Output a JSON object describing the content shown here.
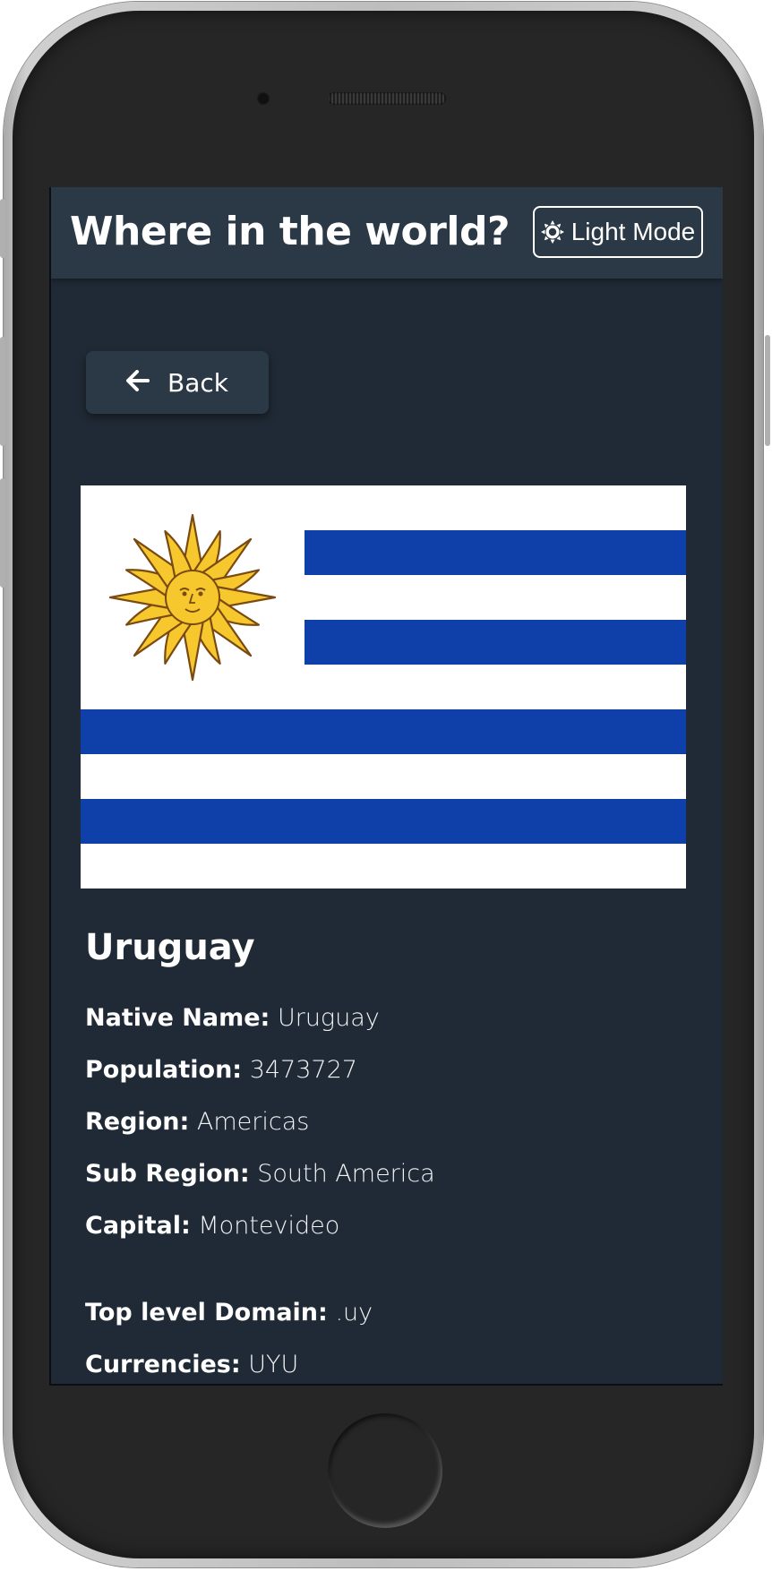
{
  "header": {
    "title": "Where in the world?",
    "mode_toggle_label": "Light Mode",
    "mode_toggle_icon": "sun-icon"
  },
  "back_button": {
    "label": "Back",
    "icon": "arrow-left-icon"
  },
  "flag": {
    "country": "Uruguay",
    "colors": {
      "blue": "#0f3fa8",
      "white": "#ffffff",
      "sun": "#f6c82d",
      "sun_outline": "#7a4a12"
    }
  },
  "country": {
    "name": "Uruguay",
    "details": [
      {
        "key": "native_name",
        "label": "Native Name:",
        "value": "Uruguay"
      },
      {
        "key": "population",
        "label": "Population:",
        "value": "3473727"
      },
      {
        "key": "region",
        "label": "Region:",
        "value": "Americas"
      },
      {
        "key": "sub_region",
        "label": "Sub Region:",
        "value": "South America"
      },
      {
        "key": "capital",
        "label": "Capital:",
        "value": "Montevideo"
      },
      {
        "key": "top_level_domain",
        "label": "Top level Domain:",
        "value": ".uy"
      },
      {
        "key": "currencies",
        "label": "Currencies:",
        "value": "UYU"
      }
    ]
  },
  "theme": {
    "background": "#202a36",
    "header_background": "#2b3845",
    "text": "#ffffff"
  }
}
